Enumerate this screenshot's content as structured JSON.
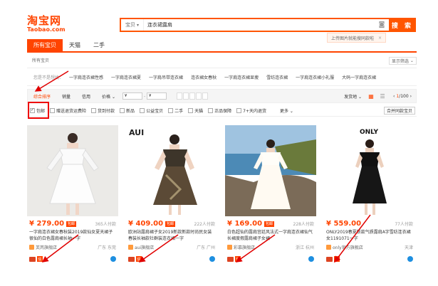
{
  "logo": {
    "cn": "淘宝网",
    "en": "Taobao.com"
  },
  "search": {
    "scope": "宝贝",
    "query": "连衣裙露肩",
    "button": "搜 索"
  },
  "tip": {
    "text": "上传图片就能搜同款啦"
  },
  "tabs": [
    {
      "label": "所有宝贝",
      "active": true
    },
    {
      "label": "天猫",
      "active": false
    },
    {
      "label": "二手",
      "active": false
    }
  ],
  "breadcrumb": "所有宝贝",
  "filter_button": "显示筛选",
  "find_row": {
    "label": "您是不是想找：",
    "keywords": [
      "一字肩连衣裙性感",
      "一字肩连衣裙夏",
      "一字肩吊带连衣裙",
      "连衣裙女春秋",
      "一字肩连衣裙显瘦",
      "雪纺连衣裙",
      "一字肩连衣裙小礼服",
      "大码一字肩连衣裙"
    ]
  },
  "sort": {
    "items": [
      "综合排序",
      "销量",
      "信用",
      "价格"
    ],
    "price_from": "¥",
    "price_to": "¥",
    "ship_to": "发货地",
    "page": "1",
    "total": "/100"
  },
  "checkboxes": [
    {
      "label": "包邮",
      "checked": true
    },
    {
      "label": "赠送退货运费险",
      "checked": false
    },
    {
      "label": "货到付款",
      "checked": false
    },
    {
      "label": "新品",
      "checked": false
    },
    {
      "label": "公益宝贝",
      "checked": false
    },
    {
      "label": "二手",
      "checked": false
    },
    {
      "label": "天猫",
      "checked": false
    },
    {
      "label": "正品保障",
      "checked": false
    },
    {
      "label": "7+天内退货",
      "checked": false
    }
  ],
  "checkbar_first": "包邮",
  "more": "更多",
  "merge_button": "合并同款宝贝",
  "products": [
    {
      "brand": "",
      "price": "¥ 279.00",
      "sold": "365人付款",
      "title": "一字肩连衣裙女春秋装2019款仙女夏天裙子很仙的白色露肩裙长袖一字",
      "shop": "芙芮旗舰店",
      "loc": "广东 东莞"
    },
    {
      "brand": "AUI",
      "price": "¥ 409.00",
      "sold": "222人付款",
      "title": "欧洲站露肩裙子女2019新款新款时尚民女装春装长袖款社群装连衣裙一字",
      "shop": "aui旗舰店",
      "loc": "广东 广州"
    },
    {
      "brand": "",
      "price": "¥ 169.00",
      "sold": "228人付款",
      "title": "白色超仙的露肩宫廷风法式一字肩连衣裙仙气长裙度假露肩裙子女裙",
      "shop": "彩慕旗舰店",
      "loc": "浙江 杭州"
    },
    {
      "brand": "ONLY",
      "price": "¥ 559.00",
      "sold": "77人付款",
      "title": "ONLY2019春夏新款气质露肩A字雪纺连衣裙女1191071一字",
      "shop": "only官方旗舰店",
      "loc": "天津"
    }
  ],
  "colors": {
    "accent": "#ff4400",
    "arrow": "#e00000"
  }
}
